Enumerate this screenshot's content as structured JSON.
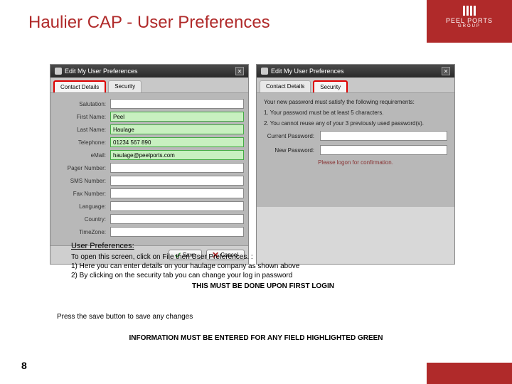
{
  "brand": {
    "name": "PEEL PORTS",
    "group": "GROUP"
  },
  "title": "Haulier CAP - User Preferences",
  "winTitle": "Edit My User Preferences",
  "closeGlyph": "✕",
  "tabs": {
    "contact": "Contact Details",
    "security": "Security"
  },
  "fields": {
    "salutation": {
      "label": "Salutation:",
      "value": ""
    },
    "firstName": {
      "label": "First Name:",
      "value": "Peel"
    },
    "lastName": {
      "label": "Last Name:",
      "value": "Haulage"
    },
    "telephone": {
      "label": "Telephone:",
      "value": "01234 567 890"
    },
    "email": {
      "label": "eMail:",
      "value": "haulage@peelports.com"
    },
    "pager": {
      "label": "Pager Number:",
      "value": ""
    },
    "sms": {
      "label": "SMS Number:",
      "value": ""
    },
    "fax": {
      "label": "Fax Number:",
      "value": ""
    },
    "language": {
      "label": "Language:",
      "value": ""
    },
    "country": {
      "label": "Country:",
      "value": ""
    },
    "timezone": {
      "label": "TimeZone:",
      "value": ""
    }
  },
  "buttons": {
    "save": "Save",
    "cancel": "Cancel"
  },
  "security": {
    "intro": "Your new password must satisfy the following requirements:",
    "rule1": "1. Your password must be at least 5 characters.",
    "rule2": "2. You cannot reuse any of your 3 previously used password(s).",
    "current": "Current Password:",
    "newpw": "New Password:",
    "hint": "Please logon for confirmation."
  },
  "instructions": {
    "heading": "User Preferences:",
    "l0": "To open this screen, click on File then User Preferences. :",
    "l1": "1)  Here you can enter details on your haulage company as shown above",
    "l2": "2)  By clicking on the security tab you can change your log in password",
    "bold": "THIS MUST BE DONE UPON FIRST LOGIN",
    "press": "Press the save button to save any changes",
    "warn": "INFORMATION MUST BE ENTERED FOR ANY FIELD HIGHLIGHTED GREEN"
  },
  "pageNumber": "8"
}
